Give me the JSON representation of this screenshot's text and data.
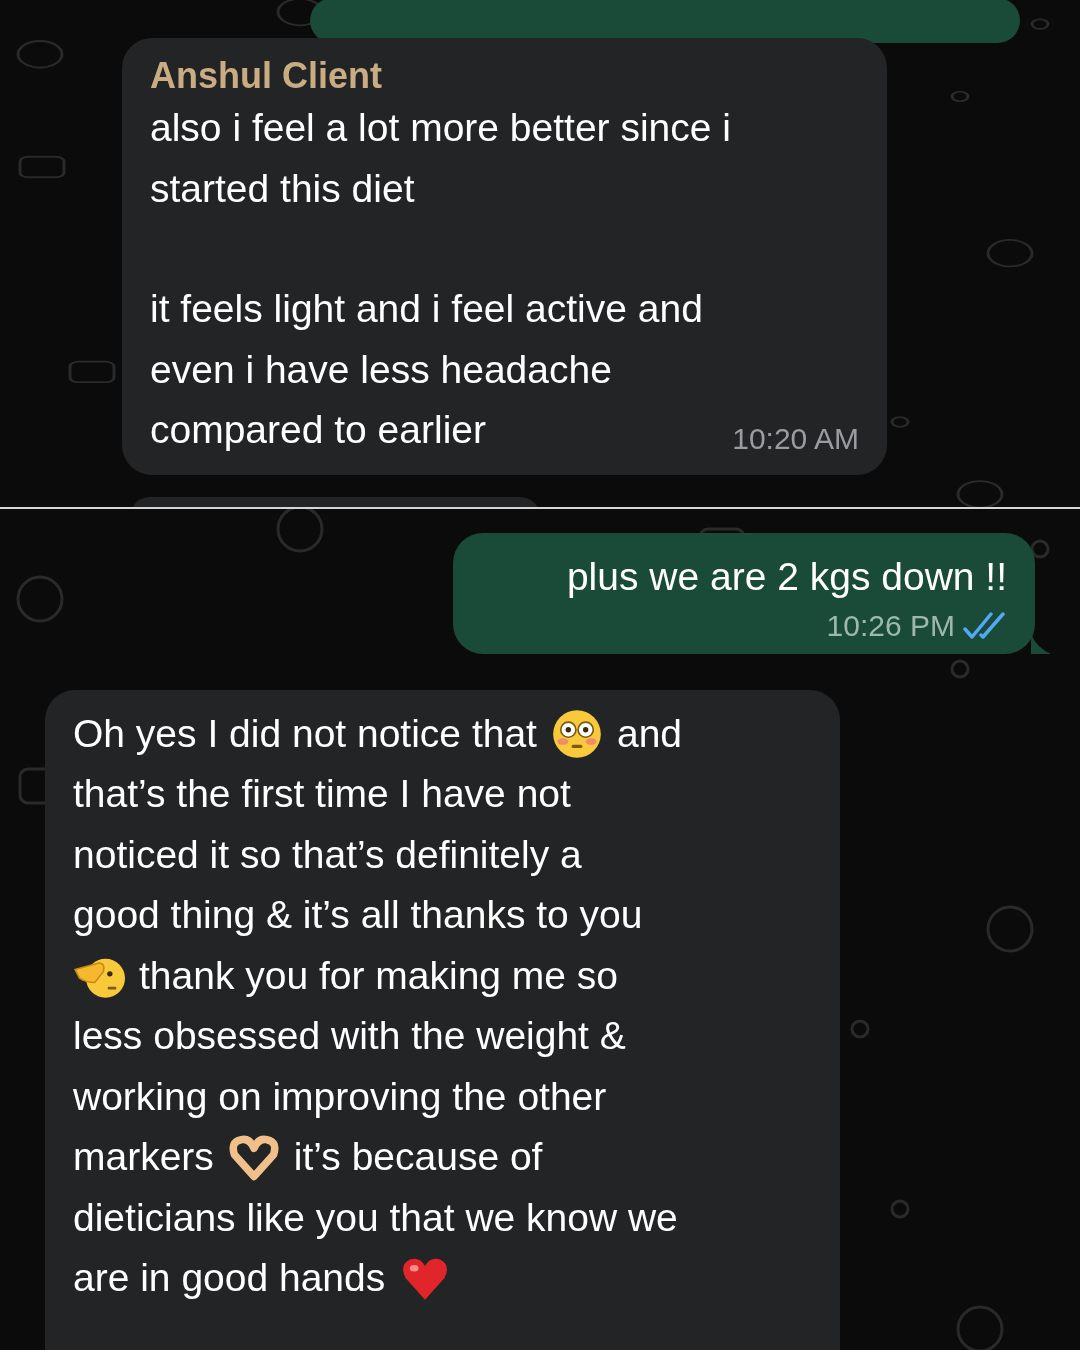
{
  "panels": [
    {
      "top_stub": {
        "kind": "outgoing"
      },
      "messages": [
        {
          "kind": "incoming",
          "sender": "Anshul Client",
          "paragraphs": [
            [
              [
                {
                  "kind": "text",
                  "text": "also i feel a lot more better since i"
                }
              ],
              [
                {
                  "kind": "text",
                  "text": "started this diet"
                }
              ]
            ],
            [
              [
                {
                  "kind": "text",
                  "text": "it feels light and i feel active and"
                }
              ],
              [
                {
                  "kind": "text",
                  "text": "even i have less headache"
                }
              ],
              [
                {
                  "kind": "text",
                  "text": "compared to earlier"
                }
              ]
            ]
          ],
          "time": "10:20 AM"
        }
      ],
      "bottom_stub": {
        "kind": "incoming"
      }
    },
    {
      "messages": [
        {
          "kind": "outgoing",
          "paragraphs": [
            [
              [
                {
                  "kind": "text",
                  "text": "plus we are 2 kgs down !!"
                }
              ]
            ]
          ],
          "time": "10:26 PM",
          "read": true
        },
        {
          "kind": "incoming",
          "paragraphs": [
            [
              [
                {
                  "kind": "text",
                  "text": "Oh yes I did not notice that"
                },
                {
                  "kind": "flushed-face"
                },
                {
                  "kind": "text",
                  "text": "and"
                }
              ],
              [
                {
                  "kind": "text",
                  "text": "that’s the first time I have not"
                }
              ],
              [
                {
                  "kind": "text",
                  "text": "noticed it so that’s definitely a"
                }
              ],
              [
                {
                  "kind": "text",
                  "text": "good thing & it’s all thanks to you"
                }
              ],
              [
                {
                  "kind": "saluting-face"
                },
                {
                  "kind": "text",
                  "text": "thank you for making me so"
                }
              ],
              [
                {
                  "kind": "text",
                  "text": "less obsessed with the weight  &"
                }
              ],
              [
                {
                  "kind": "text",
                  "text": "working on improving the other"
                }
              ],
              [
                {
                  "kind": "text",
                  "text": "markers"
                },
                {
                  "kind": "heart-hands"
                },
                {
                  "kind": "text",
                  "text": "it’s because of"
                }
              ],
              [
                {
                  "kind": "text",
                  "text": "dieticians like you that we know we"
                }
              ],
              [
                {
                  "kind": "text",
                  "text": "are in good hands"
                },
                {
                  "kind": "red-heart"
                }
              ]
            ]
          ]
        }
      ]
    }
  ]
}
